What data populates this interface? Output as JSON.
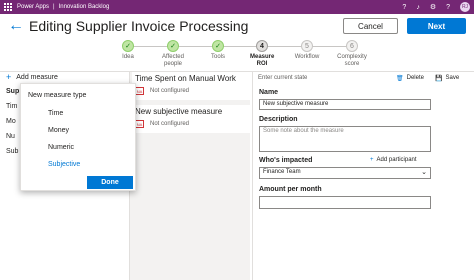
{
  "topbar": {
    "app": "Power Apps",
    "separator": "|",
    "env": "Innovation Backlog",
    "icons": [
      "help-icon",
      "bell-icon",
      "gear-icon",
      "question-icon"
    ],
    "user": "RJ"
  },
  "header": {
    "title": "Editing Supplier Invoice Processing",
    "cancel": "Cancel",
    "next": "Next"
  },
  "steps": [
    {
      "label": "Idea",
      "state": "done"
    },
    {
      "label": "Affected people",
      "state": "done"
    },
    {
      "label": "Tools",
      "state": "done"
    },
    {
      "label": "Measure ROI",
      "state": "current",
      "num": "4"
    },
    {
      "label": "Workflow",
      "state": "todo",
      "num": "5"
    },
    {
      "label": "Complexity score",
      "state": "todo",
      "num": "6"
    }
  ],
  "left": {
    "add_measure": "Add measure",
    "items": [
      "Sup",
      "Tim",
      "Mo",
      "Nu",
      "Sub"
    ]
  },
  "popup": {
    "title": "New measure type",
    "options": [
      "Time",
      "Money",
      "Numeric",
      "Subjective"
    ],
    "selected": "Subjective",
    "done": "Done"
  },
  "cards": [
    {
      "title": "Time Spent on Manual Work",
      "status": "Not configured",
      "icon": "not-configured-icon"
    },
    {
      "title": "New subjective measure",
      "status": "Not configured",
      "icon": "not-configured-icon"
    }
  ],
  "right": {
    "state_placeholder": "Enter current state",
    "delete": "Delete",
    "save": "Save",
    "name_label": "Name",
    "name_value": "New subjective measure",
    "desc_label": "Description",
    "desc_placeholder": "Some note about the measure",
    "impacted_label": "Who's impacted",
    "add_participant": "Add participant",
    "impacted_value": "Finance Team",
    "amount_label": "Amount per month",
    "amount_value": ""
  },
  "colors": {
    "brand": "#742774",
    "accent": "#0078d4",
    "done": "#107c10"
  }
}
